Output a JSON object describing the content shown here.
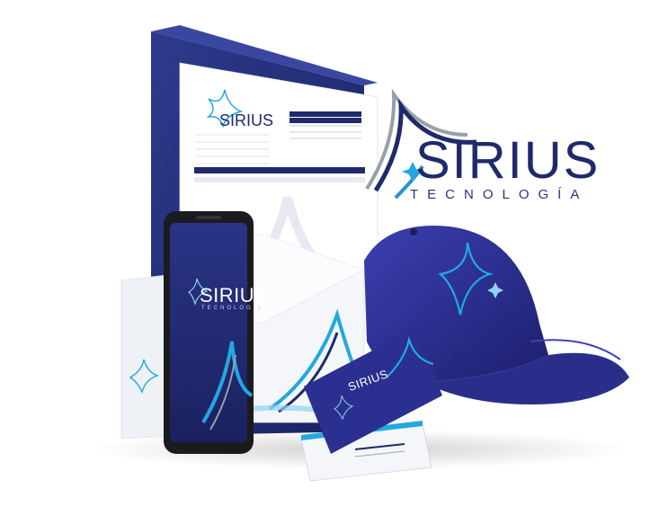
{
  "brand": {
    "name": "SIRIUS",
    "tagline": "TECNOLOGÍA"
  },
  "colors": {
    "navy": "#1f2a6b",
    "royal": "#2b2f8f",
    "cyan": "#22a8e0",
    "light_blue": "#8fd4f2",
    "gray": "#9aa0a8"
  },
  "items": [
    "folder",
    "letterhead",
    "smartphone",
    "business-cards",
    "cap",
    "envelope"
  ]
}
